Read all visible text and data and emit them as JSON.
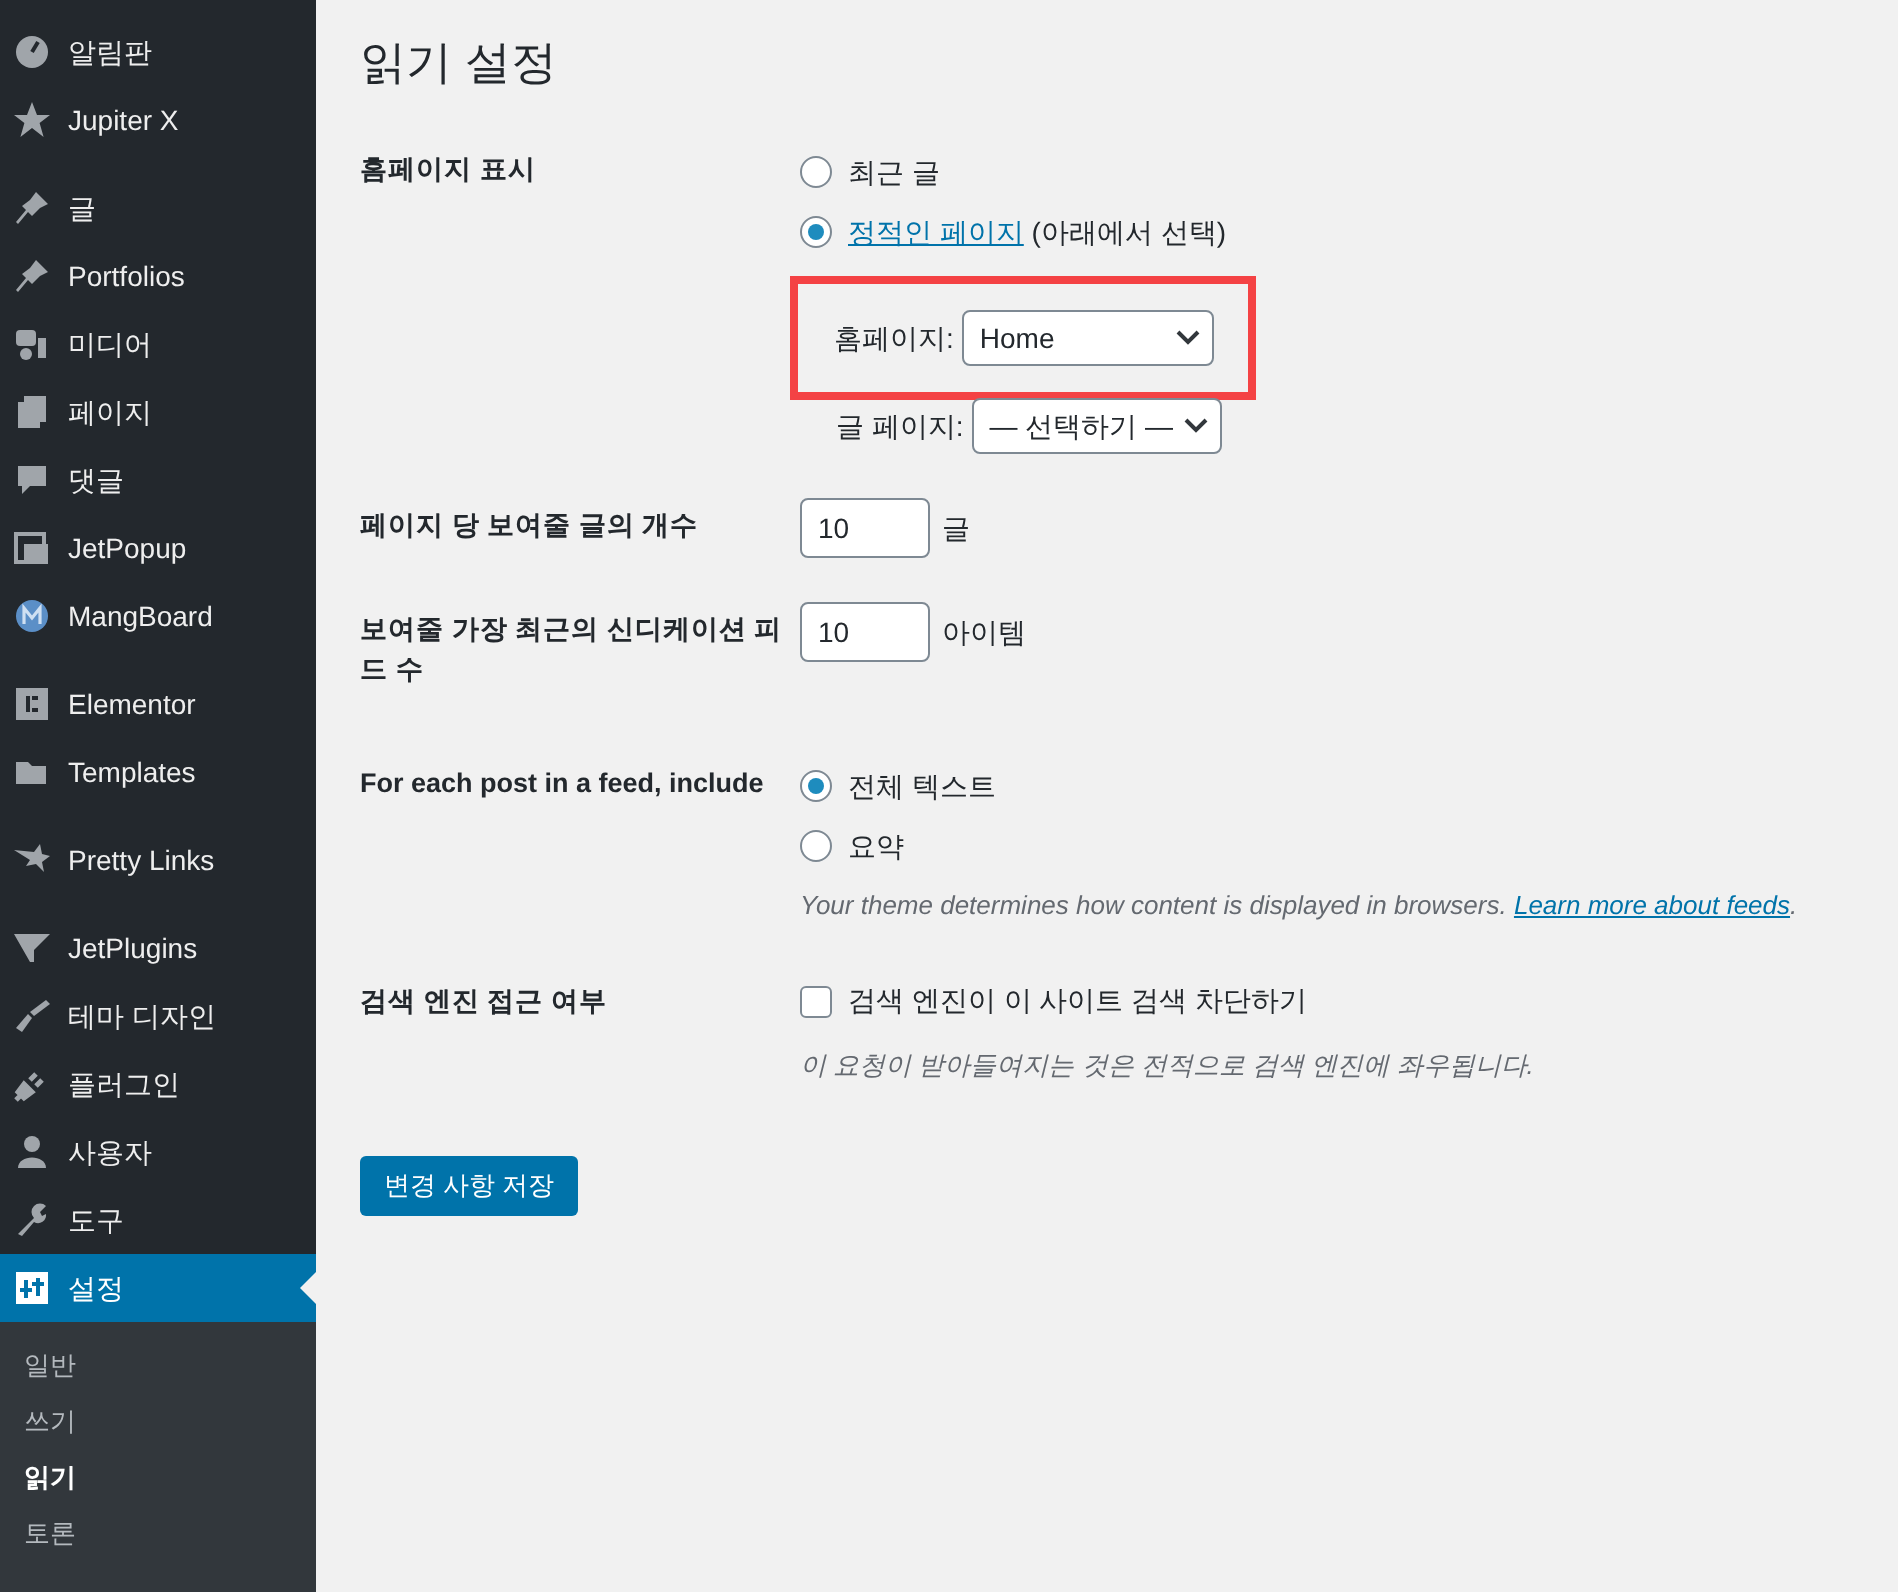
{
  "sidebar": {
    "groups": [
      [
        {
          "label": "알림판",
          "selected": false
        },
        {
          "label": "Jupiter X",
          "selected": false
        }
      ],
      [
        {
          "label": "글",
          "selected": false
        },
        {
          "label": "Portfolios",
          "selected": false
        },
        {
          "label": "미디어",
          "selected": false
        },
        {
          "label": "페이지",
          "selected": false
        },
        {
          "label": "댓글",
          "selected": false
        },
        {
          "label": "JetPopup",
          "selected": false
        },
        {
          "label": "MangBoard",
          "selected": false
        }
      ],
      [
        {
          "label": "Elementor",
          "selected": false
        },
        {
          "label": "Templates",
          "selected": false
        }
      ],
      [
        {
          "label": "Pretty Links",
          "selected": false
        }
      ],
      [
        {
          "label": "JetPlugins",
          "selected": false
        },
        {
          "label": "테마 디자인",
          "selected": false
        },
        {
          "label": "플러그인",
          "selected": false
        },
        {
          "label": "사용자",
          "selected": false
        },
        {
          "label": "도구",
          "selected": false
        },
        {
          "label": "설정",
          "selected": true
        }
      ]
    ],
    "submenu": [
      {
        "label": "일반",
        "selected": false
      },
      {
        "label": "쓰기",
        "selected": false
      },
      {
        "label": "읽기",
        "selected": true
      },
      {
        "label": "토론",
        "selected": false
      }
    ]
  },
  "page_title": "읽기 설정",
  "settings": [
    {
      "kind": "radio-group",
      "label": "홈페이지 표시",
      "options": [
        {
          "label": "최근 글",
          "selected": false
        },
        {
          "link": "정적인 페이지",
          "label": "(아래에서 선택)",
          "selected": true
        }
      ],
      "selects": [
        {
          "label": "홈페이지:",
          "value": "Home",
          "highlighted": true
        },
        {
          "label": "글 페이지:",
          "value": "— 선택하기 —",
          "highlighted": false
        }
      ]
    },
    {
      "kind": "number",
      "label": "페이지 당 보여줄 글의 개수",
      "value": "10",
      "unit": "글"
    },
    {
      "kind": "number",
      "label": "보여줄 가장 최근의 신디케이션 피드 수",
      "value": "10",
      "unit": "아이템"
    },
    {
      "kind": "radio-group",
      "label": "For each post in a feed, include",
      "options": [
        {
          "label": "전체 텍스트",
          "selected": true
        },
        {
          "label": "요약",
          "selected": false
        }
      ],
      "note": "Your theme determines how content is displayed in browsers.",
      "note_link": "Learn more about feeds",
      "note_end": "."
    },
    {
      "kind": "checkbox",
      "label": "검색 엔진 접근 여부",
      "option": {
        "label": "검색 엔진이 이 사이트 검색 차단하기",
        "checked": false
      },
      "note": "이 요청이 받아들여지는 것은 전적으로 검색 엔진에 좌우됩니다."
    }
  ],
  "save_button": "변경 사항 저장"
}
